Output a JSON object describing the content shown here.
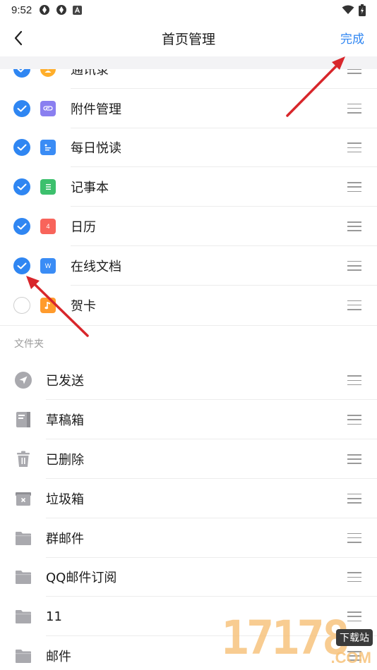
{
  "status_bar": {
    "time": "9:52"
  },
  "header": {
    "title": "首页管理",
    "done_label": "完成"
  },
  "apps": [
    {
      "label": "通讯录",
      "checked": true,
      "icon": "contacts-icon",
      "color": "#ffae2a"
    },
    {
      "label": "附件管理",
      "checked": true,
      "icon": "attachment-icon",
      "color": "#8a7ff0"
    },
    {
      "label": "每日悦读",
      "checked": true,
      "icon": "reading-icon",
      "color": "#3a8cf5"
    },
    {
      "label": "记事本",
      "checked": true,
      "icon": "notebook-icon",
      "color": "#3cc06d"
    },
    {
      "label": "日历",
      "checked": true,
      "icon": "calendar-icon",
      "color": "#f8645b",
      "glyph": "4"
    },
    {
      "label": "在线文档",
      "checked": true,
      "icon": "doc-icon",
      "color": "#3a8cf5",
      "glyph": "W"
    },
    {
      "label": "贺卡",
      "checked": false,
      "icon": "music-card-icon",
      "color": "#ff9b2d"
    }
  ],
  "folders_section": {
    "label": "文件夹"
  },
  "folders": [
    {
      "label": "已发送",
      "icon": "sent-icon"
    },
    {
      "label": "草稿箱",
      "icon": "drafts-icon"
    },
    {
      "label": "已删除",
      "icon": "trash-icon"
    },
    {
      "label": "垃圾箱",
      "icon": "spam-icon"
    },
    {
      "label": "群邮件",
      "icon": "folder-icon"
    },
    {
      "label": "QQ邮件订阅",
      "icon": "folder-icon"
    },
    {
      "label": "11",
      "icon": "folder-icon"
    },
    {
      "label": "邮件",
      "icon": "folder-icon"
    }
  ],
  "watermark": {
    "digits": "17178",
    "badge": "下载站",
    "domain": ".COM"
  },
  "colors": {
    "accent": "#2f86f2",
    "annotation": "#d8262b",
    "icon_gray": "#a9a9ae"
  }
}
